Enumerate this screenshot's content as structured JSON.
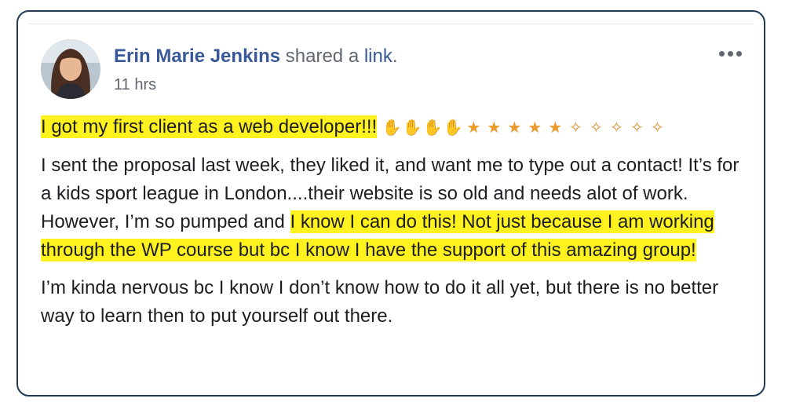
{
  "post": {
    "author": "Erin Marie Jenkins",
    "shared_text": " shared a ",
    "link_text": "link",
    "period": ".",
    "time": "11 hrs",
    "highlight_intro": "I got my first client as a web developer!!!",
    "emojis": [
      {
        "name": "clap",
        "glyph": "✋"
      },
      {
        "name": "clap",
        "glyph": "✋"
      },
      {
        "name": "clap",
        "glyph": "✋"
      },
      {
        "name": "clap",
        "glyph": "✋"
      },
      {
        "name": "party",
        "glyph": "★"
      },
      {
        "name": "party",
        "glyph": "★"
      },
      {
        "name": "party",
        "glyph": "★"
      },
      {
        "name": "party",
        "glyph": "★"
      },
      {
        "name": "party",
        "glyph": "★"
      },
      {
        "name": "confetti",
        "glyph": "✧"
      },
      {
        "name": "confetti",
        "glyph": "✧"
      },
      {
        "name": "confetti",
        "glyph": "✧"
      },
      {
        "name": "confetti",
        "glyph": "✧"
      },
      {
        "name": "confetti",
        "glyph": "✧"
      }
    ],
    "para2_plain": "I sent the proposal last week, they liked it, and want me to type out a contact! It’s for a kids sport league in London....their website is so old and needs alot of work. However, I’m so pumped and ",
    "para2_highlight": "I know I can do this! Not just because I am working through the WP course but bc I know I have the support of this amazing group!",
    "para3": "I’m kinda nervous bc I know I don’t know how to do it all yet, but there is no better way to learn then to put yourself out there."
  },
  "colors": {
    "highlight": "#fff21f",
    "link": "#385898",
    "border": "#1f3b57"
  }
}
